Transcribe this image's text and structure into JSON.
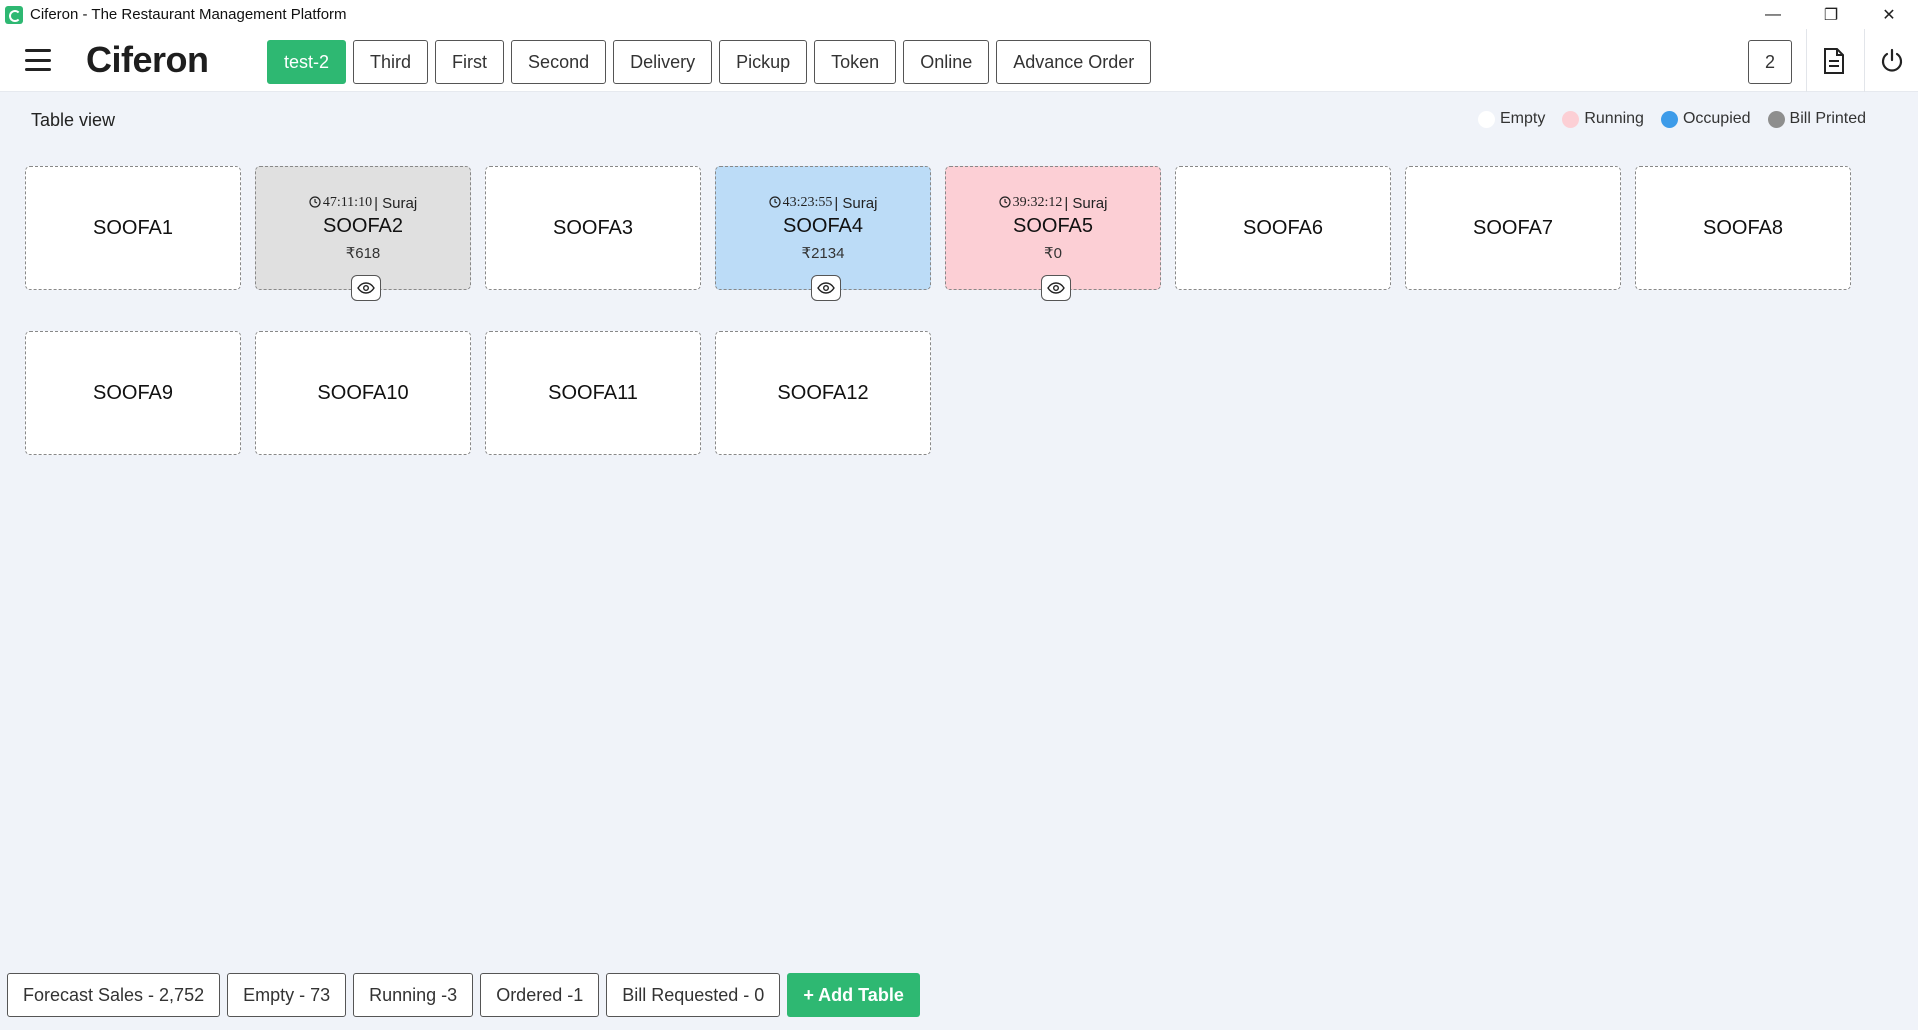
{
  "window": {
    "title": "Ciferon - The Restaurant Management Platform",
    "minimize_glyph": "—",
    "restore_glyph": "❐",
    "close_glyph": "✕"
  },
  "header": {
    "logo": "Ciferon",
    "tabs": [
      {
        "label": "test-2",
        "active": true
      },
      {
        "label": "Third"
      },
      {
        "label": "First"
      },
      {
        "label": "Second"
      },
      {
        "label": "Delivery"
      },
      {
        "label": "Pickup"
      },
      {
        "label": "Token"
      },
      {
        "label": "Online"
      },
      {
        "label": "Advance Order"
      }
    ],
    "count": "2",
    "icons": [
      "document-icon",
      "power-icon"
    ]
  },
  "view": {
    "title": "Table view"
  },
  "legend": [
    {
      "label": "Empty",
      "color": "#ffffff"
    },
    {
      "label": "Running",
      "color": "#fccfd5"
    },
    {
      "label": "Occupied",
      "color": "#3d9be9"
    },
    {
      "label": "Bill Printed",
      "color": "#8e8e8e"
    }
  ],
  "tables": [
    {
      "name": "SOOFA1",
      "status": "empty"
    },
    {
      "name": "SOOFA2",
      "status": "billprinted",
      "time": "47:11:10",
      "user": "| Suraj",
      "amount": "₹618"
    },
    {
      "name": "SOOFA3",
      "status": "empty"
    },
    {
      "name": "SOOFA4",
      "status": "occupied",
      "time": "43:23:55",
      "user": "| Suraj",
      "amount": "₹2134"
    },
    {
      "name": "SOOFA5",
      "status": "running",
      "time": "39:32:12",
      "user": "| Suraj",
      "amount": "₹0"
    },
    {
      "name": "SOOFA6",
      "status": "empty"
    },
    {
      "name": "SOOFA7",
      "status": "empty"
    },
    {
      "name": "SOOFA8",
      "status": "empty"
    },
    {
      "name": "SOOFA9",
      "status": "empty"
    },
    {
      "name": "SOOFA10",
      "status": "empty"
    },
    {
      "name": "SOOFA11",
      "status": "empty"
    },
    {
      "name": "SOOFA12",
      "status": "empty"
    }
  ],
  "footer": {
    "stats": [
      "Forecast Sales - 2,752",
      "Empty - 73",
      "Running -3",
      "Ordered -1",
      "Bill Requested - 0"
    ],
    "add_button": "+ Add Table"
  },
  "colors": {
    "accent": "#2eb872",
    "bill_printed_bg": "#e0e0e0",
    "occupied_bg": "#bcdcf7",
    "running_bg": "#fccfd5"
  }
}
